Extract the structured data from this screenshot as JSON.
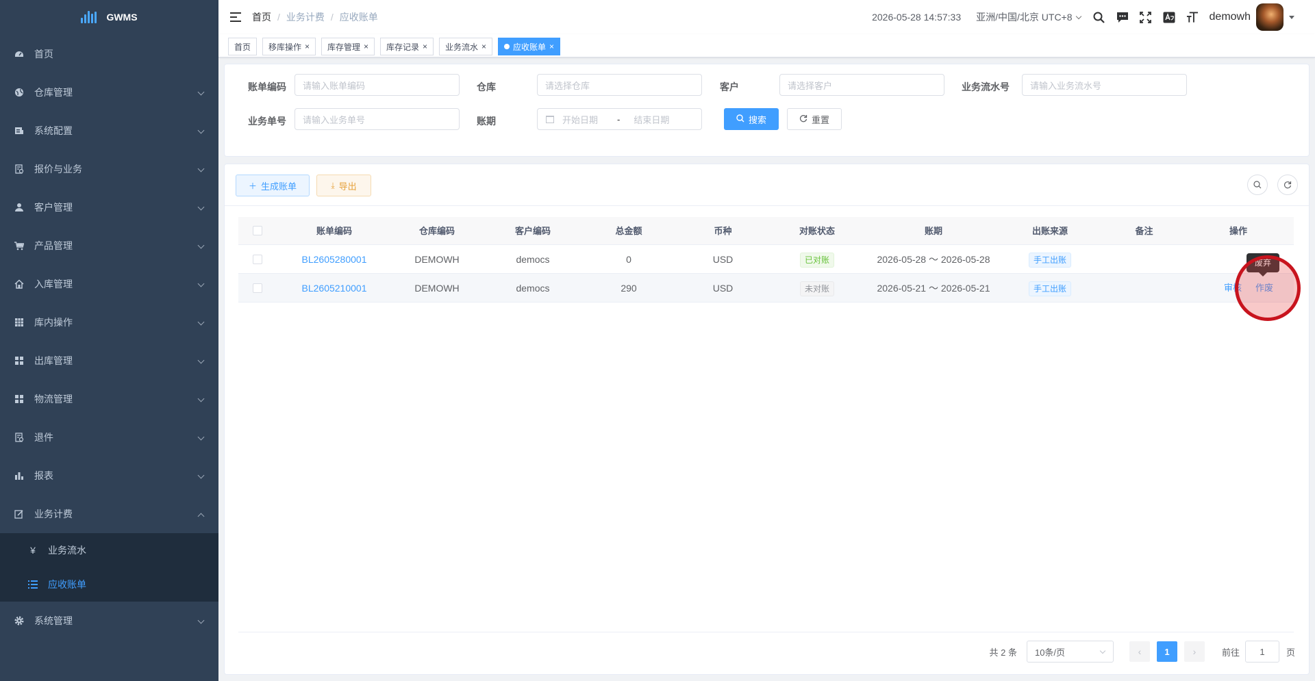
{
  "app": {
    "logo_text": "GWMS"
  },
  "sidebar": {
    "items": [
      {
        "label": "首页",
        "icon": "dashboard-icon"
      },
      {
        "label": "仓库管理",
        "icon": "globe-icon"
      },
      {
        "label": "系统配置",
        "icon": "config-icon"
      },
      {
        "label": "报价与业务",
        "icon": "quote-icon"
      },
      {
        "label": "客户管理",
        "icon": "user-icon"
      },
      {
        "label": "产品管理",
        "icon": "cart-icon"
      },
      {
        "label": "入库管理",
        "icon": "home-icon"
      },
      {
        "label": "库内操作",
        "icon": "table-icon"
      },
      {
        "label": "出库管理",
        "icon": "grid-icon"
      },
      {
        "label": "物流管理",
        "icon": "grid-icon"
      },
      {
        "label": "退件",
        "icon": "return-icon"
      },
      {
        "label": "报表",
        "icon": "chart-icon"
      },
      {
        "label": "业务计费",
        "icon": "edit-icon"
      },
      {
        "label": "系统管理",
        "icon": "gear-icon"
      }
    ],
    "sub_items": [
      {
        "label": "业务流水",
        "icon": "yen-icon"
      },
      {
        "label": "应收账单",
        "icon": "list-icon"
      }
    ]
  },
  "navbar": {
    "breadcrumb": [
      "首页",
      "业务计费",
      "应收账单"
    ],
    "datetime": "2026-05-28 14:57:33",
    "timezone": "亚洲/中国/北京 UTC+8",
    "username": "demowh"
  },
  "tags": [
    "首页",
    "移库操作",
    "库存管理",
    "库存记录",
    "业务流水",
    "应收账单"
  ],
  "search": {
    "bill_code_label": "账单编码",
    "bill_code_placeholder": "请输入账单编码",
    "warehouse_label": "仓库",
    "warehouse_placeholder": "请选择仓库",
    "customer_label": "客户",
    "customer_placeholder": "请选择客户",
    "flow_no_label": "业务流水号",
    "flow_no_placeholder": "请输入业务流水号",
    "biz_no_label": "业务单号",
    "biz_no_placeholder": "请输入业务单号",
    "period_label": "账期",
    "start_placeholder": "开始日期",
    "range_sep": "-",
    "end_placeholder": "结束日期",
    "search_btn": "搜索",
    "reset_btn": "重置"
  },
  "toolbar": {
    "generate_btn": "生成账单",
    "export_btn": "导出"
  },
  "table": {
    "columns": [
      "账单编码",
      "仓库编码",
      "客户编码",
      "总金额",
      "币种",
      "对账状态",
      "账期",
      "出账来源",
      "备注",
      "操作"
    ],
    "rows": [
      {
        "code": "BL2605280001",
        "warehouse": "DEMOWH",
        "customer": "democs",
        "amount": "0",
        "currency": "USD",
        "status": "已对账",
        "status_type": "success",
        "period": "2026-05-28 ～ 2026-05-28",
        "source": "手工出账",
        "remark": ""
      },
      {
        "code": "BL2605210001",
        "warehouse": "DEMOWH",
        "customer": "democs",
        "amount": "290",
        "currency": "USD",
        "status": "未对账",
        "status_type": "info",
        "period": "2026-05-21 ～ 2026-05-21",
        "source": "手工出账",
        "remark": "",
        "actions": [
          "审核",
          "作废"
        ]
      }
    ]
  },
  "tooltip": {
    "text": "废弃"
  },
  "pagination": {
    "total": "共 2 条",
    "page_size": "10条/页",
    "current": "1",
    "goto_label": "前往",
    "goto_value": "1",
    "page_suffix": "页"
  }
}
